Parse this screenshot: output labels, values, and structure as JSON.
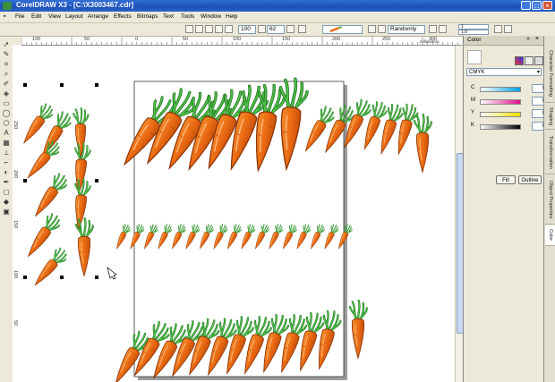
{
  "window": {
    "title": "CorelDRAW X3 - [C:\\X3003467.cdr]",
    "controls": [
      "_",
      "□",
      "×"
    ]
  },
  "menu": [
    "File",
    "Edit",
    "View",
    "Layout",
    "Arrange",
    "Effects",
    "Bitmaps",
    "Text",
    "Tools",
    "Window",
    "Help"
  ],
  "property_bar": {
    "angle_value": "100",
    "size_value": "62",
    "spray_mode": "Randomly",
    "spacing_1": "1",
    "spacing_2": "1.0"
  },
  "rulers": {
    "horizontal": [
      "100",
      "50",
      "0",
      "50",
      "100",
      "150",
      "200",
      "250",
      "300"
    ],
    "horizontal_unit": "millimeters",
    "vertical": [
      "250",
      "200",
      "150",
      "100",
      "50"
    ]
  },
  "docker": {
    "title": "Color",
    "model": "CMYK",
    "channels": [
      {
        "label": "C",
        "value": "0",
        "color": "#00a0e0"
      },
      {
        "label": "M",
        "value": "0",
        "color": "#e0108c"
      },
      {
        "label": "Y",
        "value": "0",
        "color": "#f0e000"
      },
      {
        "label": "K",
        "value": "0",
        "color": "#000000"
      }
    ],
    "fill_label": "Fill",
    "outline_label": "Outline"
  },
  "docker_tabs": [
    "Character Formatting",
    "Shaping",
    "Transformation",
    "Object Properties",
    "Color"
  ],
  "colors": {
    "carrot": "#ea6a12",
    "carrot_dark": "#b8470a",
    "leaf": "#3fae3a",
    "leaf_dark": "#1f6d1f",
    "titlebar": "#1d4fb8"
  },
  "tools": [
    "pick-icon",
    "shape-icon",
    "crop-icon",
    "zoom-icon",
    "freehand-icon",
    "smart-fill-icon",
    "rectangle-icon",
    "ellipse-icon",
    "polygon-icon",
    "text-icon",
    "table-icon",
    "dimension-icon",
    "connector-icon",
    "blend-icon",
    "eyedropper-icon",
    "outline-icon",
    "fill-icon",
    "interactive-fill-icon"
  ]
}
